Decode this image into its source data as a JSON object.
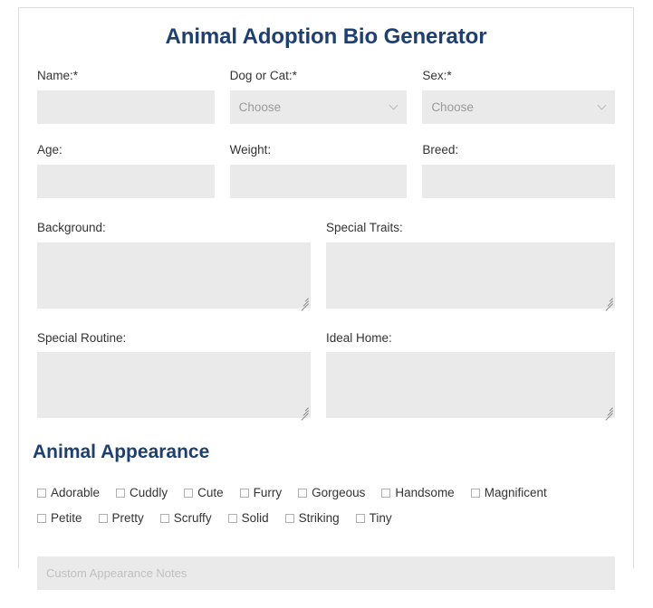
{
  "form": {
    "title": "Animal Adoption Bio Generator",
    "row1": [
      {
        "label": "Name:*",
        "type": "text",
        "value": "",
        "placeholder": ""
      },
      {
        "label": "Dog or Cat:*",
        "type": "select",
        "value": "Choose"
      },
      {
        "label": "Sex:*",
        "type": "select",
        "value": "Choose"
      }
    ],
    "row2": [
      {
        "label": "Age:",
        "type": "text",
        "value": "",
        "placeholder": ""
      },
      {
        "label": "Weight:",
        "type": "text",
        "value": "",
        "placeholder": ""
      },
      {
        "label": "Breed:",
        "type": "text",
        "value": "",
        "placeholder": ""
      }
    ],
    "row3": [
      {
        "label": "Background:",
        "type": "textarea",
        "value": ""
      },
      {
        "label": "Special Traits:",
        "type": "textarea",
        "value": ""
      }
    ],
    "row4": [
      {
        "label": "Special Routine:",
        "type": "textarea",
        "value": ""
      },
      {
        "label": "Ideal Home:",
        "type": "textarea",
        "value": ""
      }
    ]
  },
  "appearance": {
    "heading": "Animal Appearance",
    "checkboxes": [
      {
        "label": "Adorable",
        "checked": false
      },
      {
        "label": "Cuddly",
        "checked": false
      },
      {
        "label": "Cute",
        "checked": false
      },
      {
        "label": "Furry",
        "checked": false
      },
      {
        "label": "Gorgeous",
        "checked": false
      },
      {
        "label": "Handsome",
        "checked": false
      },
      {
        "label": "Magnificent",
        "checked": false
      },
      {
        "label": "Petite",
        "checked": false
      },
      {
        "label": "Pretty",
        "checked": false
      },
      {
        "label": "Scruffy",
        "checked": false
      },
      {
        "label": "Solid",
        "checked": false
      },
      {
        "label": "Striking",
        "checked": false
      },
      {
        "label": "Tiny",
        "checked": false
      }
    ],
    "notes": {
      "value": "",
      "placeholder": "Custom Appearance Notes"
    }
  },
  "colors": {
    "heading_navy": "#1d3f72",
    "field_gray": "#eaeaea",
    "label_text": "#333333",
    "placeholder_gray": "#b4b4b4",
    "border_gray": "#dcdcdc"
  },
  "icons": {
    "chevron_down": "chevron-down-icon",
    "resize_grip": "resize-grip-icon",
    "checkbox": "checkbox-icon"
  }
}
